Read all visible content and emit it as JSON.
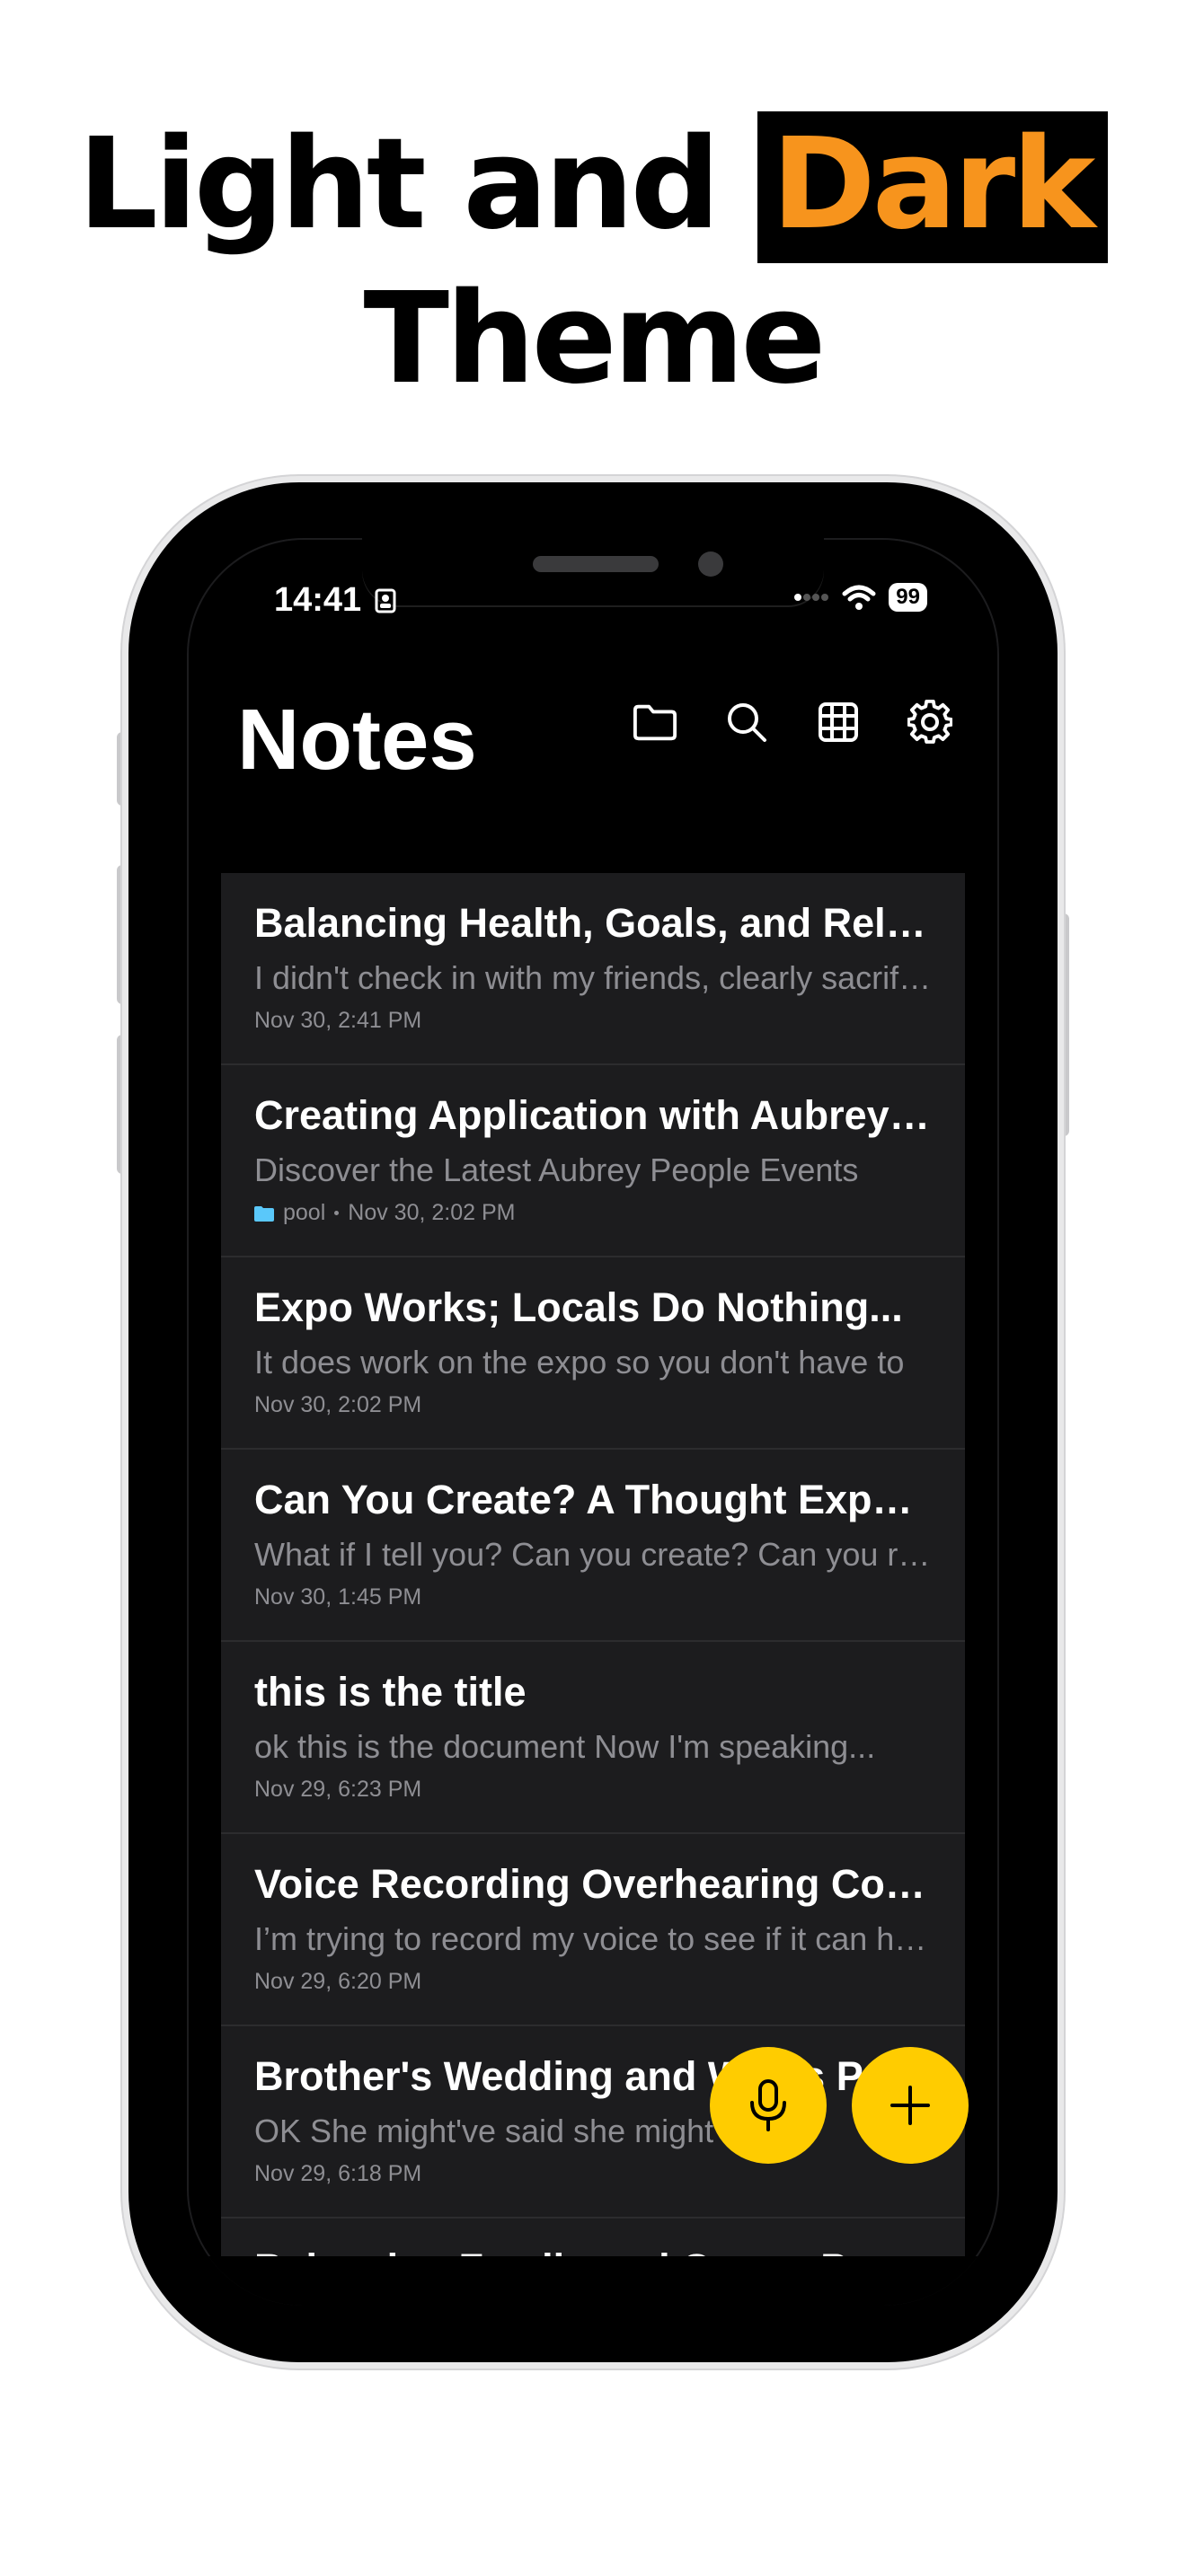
{
  "headline": {
    "line1": "Light and ",
    "highlight": "Dark",
    "line2": "Theme"
  },
  "status": {
    "time": "14:41",
    "battery": "99"
  },
  "app": {
    "title": "Notes"
  },
  "toolbar_icons": [
    "folder-icon",
    "search-icon",
    "grid-icon",
    "gear-icon"
  ],
  "notes": [
    {
      "title": "Balancing Health, Goals, and Relationships",
      "preview": "I didn't check in with my friends, clearly sacrificing",
      "date": "Nov 30, 2:41 PM"
    },
    {
      "title": "Creating Application with Aubrey People",
      "preview": "Discover the Latest Aubrey People Events",
      "folder": "pool",
      "date": "Nov 30, 2:02 PM"
    },
    {
      "title": "Expo Works; Locals Do Nothing...",
      "preview": "It does work on the expo so you don't have to",
      "date": "Nov 30, 2:02 PM"
    },
    {
      "title": "Can You Create? A Thought Experiment",
      "preview": "What if I tell you? Can you create? Can you really",
      "date": "Nov 30, 1:45 PM"
    },
    {
      "title": "this is the title",
      "preview": "ok this is the document Now I'm speaking...",
      "date": "Nov 29, 6:23 PM"
    },
    {
      "title": "Voice Recording Overhearing Conversations",
      "preview": "I’m trying to record my voice to see if it can hear",
      "date": "Nov 29, 6:20 PM"
    },
    {
      "title": "Brother's Wedding and Wife's P",
      "preview": "OK She might've said she might end",
      "date": "Nov 29, 6:18 PM"
    },
    {
      "title": "Balancing Family and Career P",
      "preview": "",
      "date": ""
    }
  ],
  "colors": {
    "accent": "#ffcc00",
    "highlight": "#f7941d",
    "card": "#1c1c1e"
  }
}
